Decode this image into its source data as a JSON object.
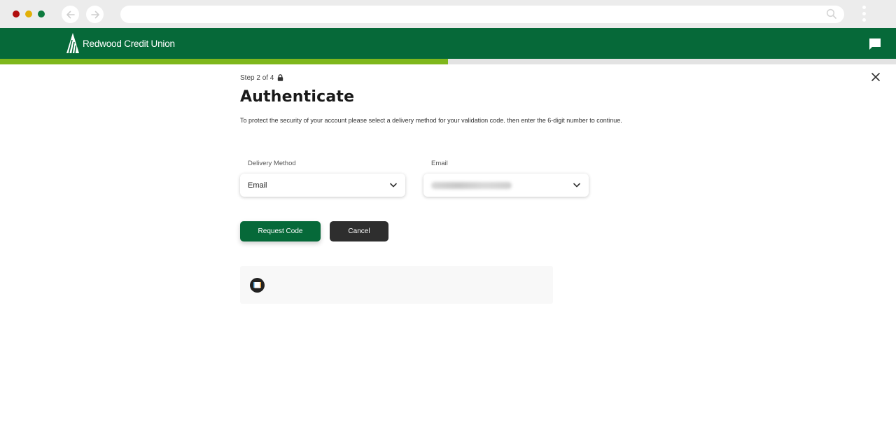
{
  "browser": {
    "window_controls": [
      "close",
      "minimize",
      "maximize"
    ],
    "nav": {
      "back_icon": "arrow-left-icon",
      "forward_icon": "arrow-right-icon"
    },
    "address_value": "",
    "search_icon": "search-icon",
    "menu_icon": "kebab-menu-icon"
  },
  "header": {
    "brand": "Redwood Credit Union",
    "logo_icon": "tree-logo-icon",
    "chat_icon": "chat-bubble-icon",
    "brand_color": "#066939",
    "accent_color": "#7fb71c"
  },
  "progress": {
    "current_step": 2,
    "total_steps": 4,
    "percent": 50
  },
  "page": {
    "step_label": "Step 2 of 4",
    "lock_icon": "lock-icon",
    "title": "Authenticate",
    "description": "To protect the security of your account please select a delivery method for your validation code. then enter the 6-digit number to continue.",
    "close_icon": "close-icon"
  },
  "form": {
    "delivery_method": {
      "label": "Delivery Method",
      "value": "Email"
    },
    "email": {
      "label": "Email",
      "value": "[redacted]"
    }
  },
  "actions": {
    "request_code_label": "Request Code",
    "cancel_label": "Cancel"
  },
  "info_box": {
    "icon": "chat-icon",
    "text": ""
  }
}
